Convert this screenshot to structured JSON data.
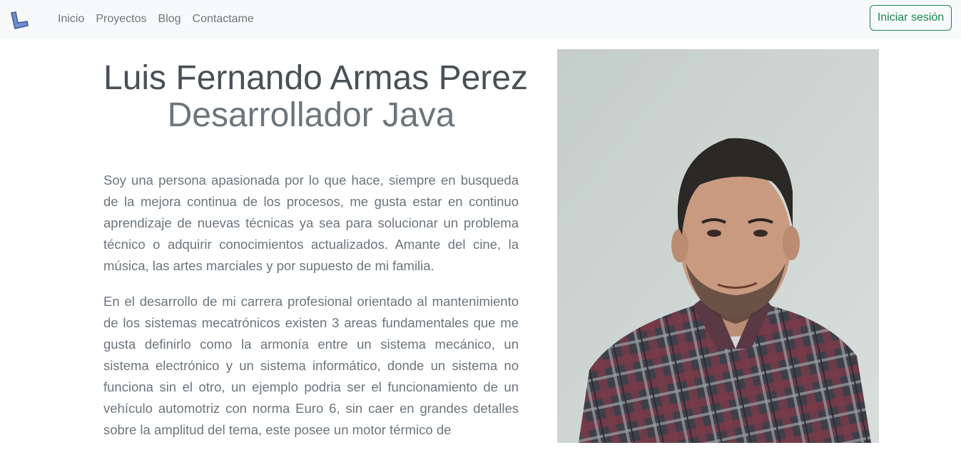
{
  "nav": {
    "brand_icon": "L-logo-icon",
    "links": [
      "Inicio",
      "Proyectos",
      "Blog",
      "Contactame"
    ],
    "login_label": "Iniciar sesión"
  },
  "hero": {
    "name": "Luis Fernando Armas Perez",
    "role": "Desarrollador Java"
  },
  "about": {
    "paragraphs": [
      "Soy una persona apasionada por lo que hace, siempre en busqueda de la mejora continua de los procesos, me gusta estar en continuo aprendizaje de nuevas técnicas ya sea para solucionar un problema técnico o adquirir conocimientos actualizados. Amante del cine, la música, las artes marciales y por supuesto de mi familia.",
      "En el desarrollo de mi carrera profesional orientado al mantenimiento de los sistemas mecatrónicos existen 3 areas fundamentales que me gusta definirlo como la armonía entre un sistema mecánico, un sistema electrónico y un sistema informático, donde un sistema no funciona sin el otro, un ejemplo podria ser el funcionamiento de un vehículo automotriz con norma Euro 6, sin caer en grandes detalles sobre la amplitud del tema, este posee un motor térmico de"
    ]
  },
  "colors": {
    "navbar_bg": "#f8f9fa",
    "accent_green": "#198754",
    "text_muted": "#6c757d"
  }
}
